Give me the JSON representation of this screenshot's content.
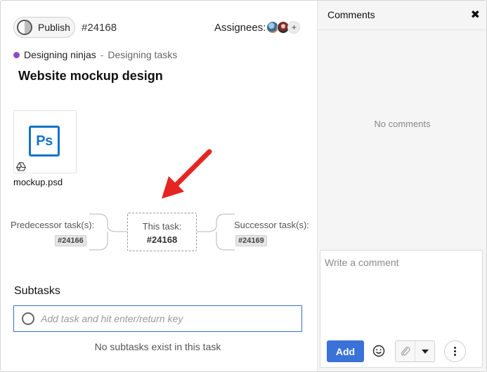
{
  "header": {
    "publish_label": "Publish",
    "task_id": "#24168",
    "assignees_label": "Assignees:",
    "add_assignee_glyph": "+"
  },
  "project": {
    "name": "Designing ninjas",
    "separator": "-",
    "tasklist": "Designing tasks",
    "dot_color": "#8b4ec2"
  },
  "task": {
    "title": "Website mockup design"
  },
  "attachment": {
    "icon_text": "Ps",
    "file_name": "mockup.psd",
    "icon_color": "#1473c9",
    "source_icon": "google-drive-icon"
  },
  "dependencies": {
    "predecessor_label": "Predecessor task(s):",
    "predecessor_tag": "#24166",
    "this_label": "This task:",
    "this_value": "#24168",
    "successor_label": "Successor task(s):",
    "successor_tag": "#24169",
    "annotation_arrow_color": "#e52521"
  },
  "subtasks": {
    "title": "Subtasks",
    "input_placeholder": "Add task and hit enter/return key",
    "empty_text": "No subtasks exist in this task"
  },
  "comments": {
    "title": "Comments",
    "close_glyph": "✖",
    "empty_text": "No comments",
    "input_placeholder": "Write a comment",
    "add_label": "Add",
    "accent_color": "#3a72d8"
  }
}
